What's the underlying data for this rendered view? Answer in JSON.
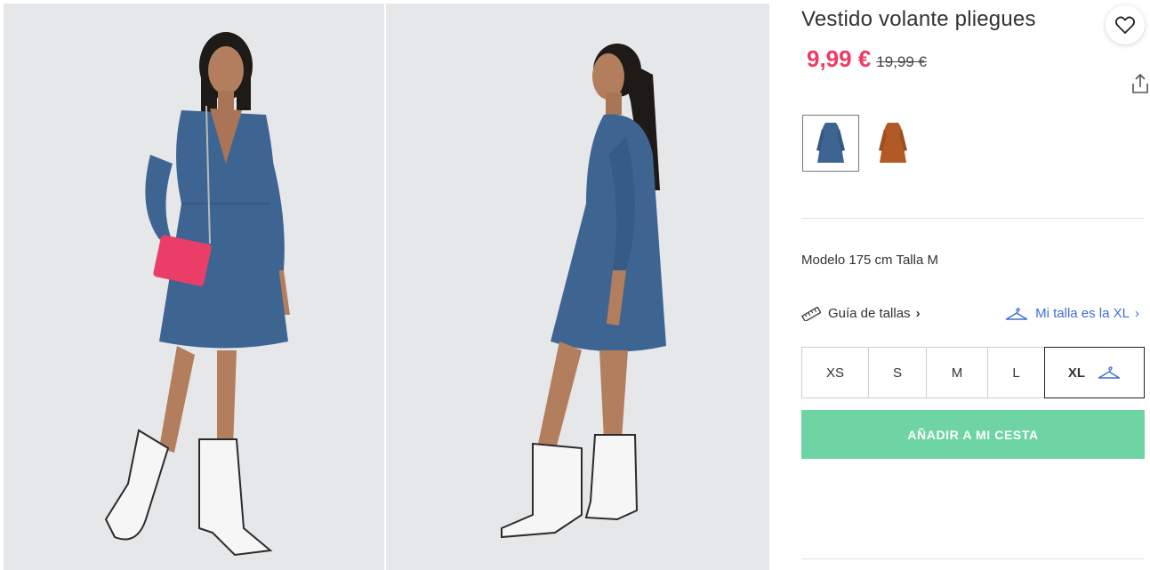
{
  "product": {
    "title": "Vestido volante pliegues",
    "price_current": "9,99 €",
    "price_original": "19,99 €",
    "model_info": "Modelo 175 cm Talla M"
  },
  "colors": {
    "accent_price": "#ef3b62",
    "cta_background": "#6fd4a4",
    "link_blue": "#3c6fd6",
    "dress_blue": "#3e6592",
    "dress_brown": "#b15a25"
  },
  "swatches": [
    {
      "name": "blue",
      "selected": true
    },
    {
      "name": "brown",
      "selected": false
    }
  ],
  "size_guide": {
    "label": "Guía de tallas",
    "icon": "ruler-icon"
  },
  "my_size": {
    "label": "Mi talla es la XL",
    "icon": "hanger-icon"
  },
  "sizes": [
    "XS",
    "S",
    "M",
    "L",
    "XL"
  ],
  "selected_size": "XL",
  "cta": {
    "label": "AÑADIR A MI CESTA"
  },
  "icons": {
    "favorite": "heart-icon",
    "share": "share-icon"
  }
}
